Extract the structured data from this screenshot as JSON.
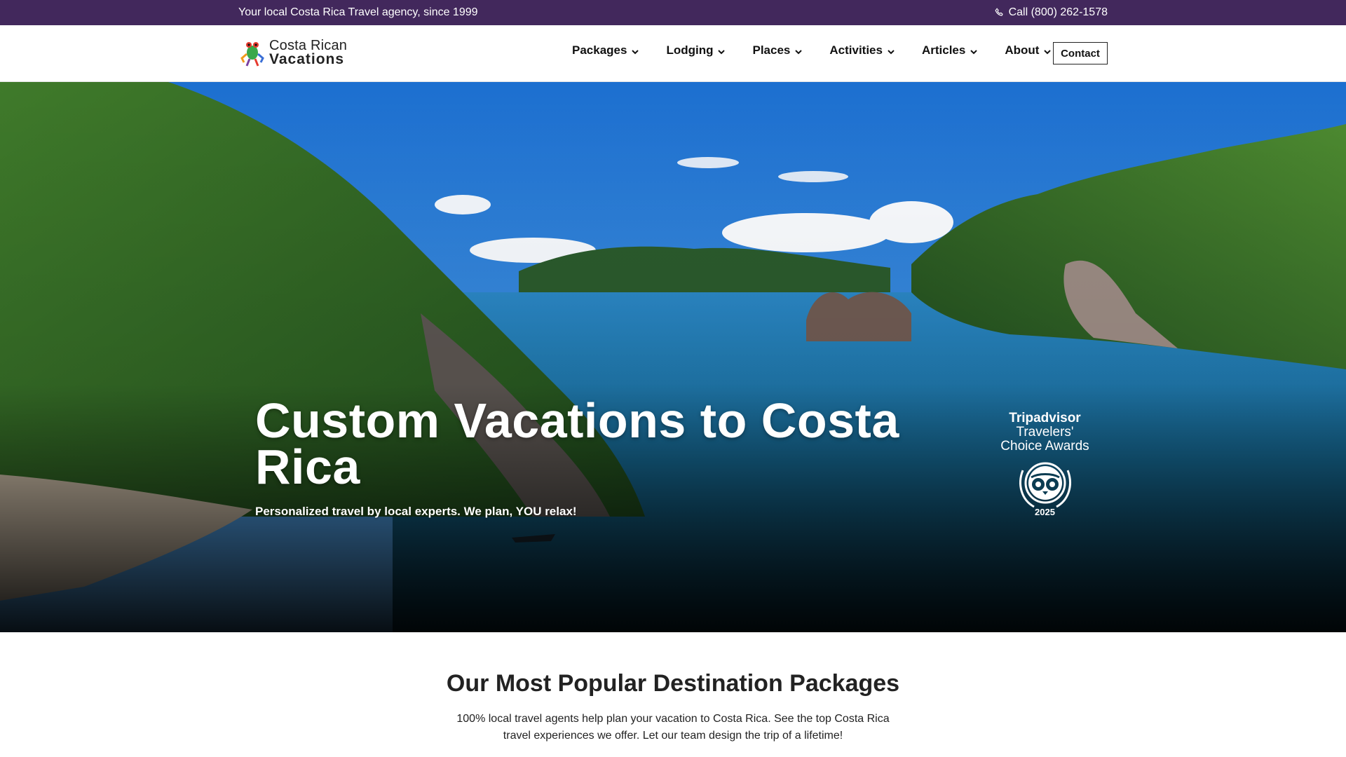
{
  "topbar": {
    "tagline": "Your local Costa Rica Travel agency, since 1999",
    "phone": "Call (800) 262-1578",
    "phone_icon": "phone-icon"
  },
  "header": {
    "logo": {
      "line1": "Costa Rican",
      "line2": "Vacations",
      "icon": "frog-logo-icon"
    },
    "nav": [
      {
        "label": "Packages",
        "icon": "chevron-down-icon"
      },
      {
        "label": "Lodging",
        "icon": "chevron-down-icon"
      },
      {
        "label": "Places",
        "icon": "chevron-down-icon"
      },
      {
        "label": "Activities",
        "icon": "chevron-down-icon"
      },
      {
        "label": "Articles",
        "icon": "chevron-down-icon"
      },
      {
        "label": "About",
        "icon": "chevron-down-icon"
      }
    ],
    "contact_label": "Contact"
  },
  "hero": {
    "title": "Custom Vacations to Costa Rica",
    "subtitle": "Personalized travel by local experts. We plan, YOU relax!",
    "award": {
      "brand": "Tripadvisor",
      "line2": "Travelers'",
      "line3": "Choice Awards",
      "year": "2025",
      "icon": "tripadvisor-owl-icon"
    }
  },
  "popular": {
    "heading": "Our Most Popular Destination Packages",
    "description": "100% local travel agents help plan your vacation to Costa Rica. See the top Costa Rica travel experiences we offer. Let our team design the trip of a lifetime!"
  },
  "colors": {
    "topbar_bg": "#42285c",
    "text_dark": "#222222",
    "hero_water": "#1f6f9a",
    "hero_sky": "#2f86d6"
  }
}
